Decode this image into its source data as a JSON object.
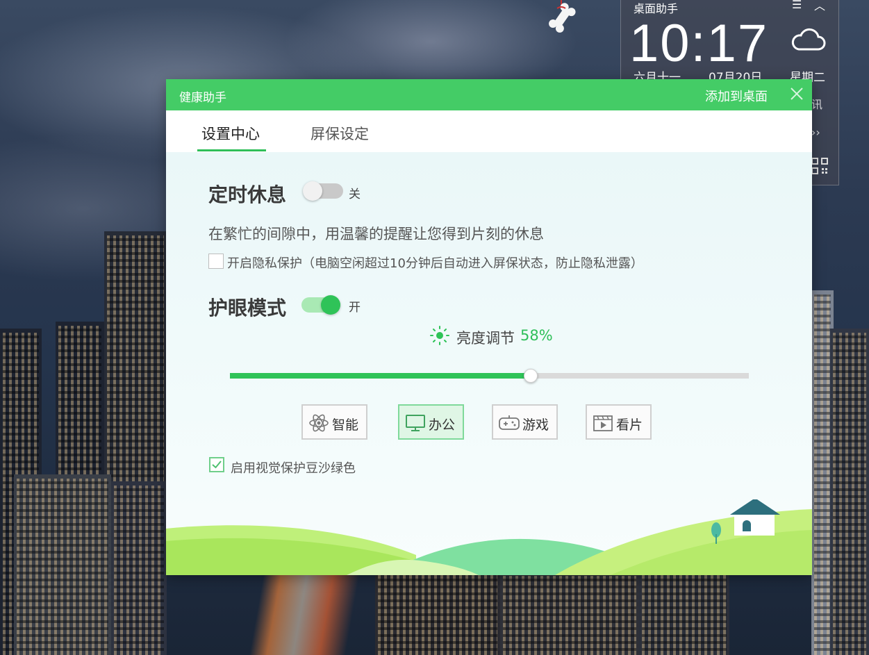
{
  "desktop_widget": {
    "title": "桌面助手",
    "menu_icon": "menu-icon",
    "collapse_icon": "chevron-up-icon",
    "time": "10:17",
    "weather_icon": "cloud-icon",
    "lunar_date": "六月十一",
    "date": "07月20日",
    "weekday": "星期二",
    "side_char_1": "讯",
    "side_icon_2": "chevron-right-icon",
    "side_icon_3": "qr-code-icon"
  },
  "dialog": {
    "title": "健康助手",
    "add_to_desktop": "添加到桌面",
    "close_icon": "close-icon",
    "tabs": [
      {
        "label": "设置中心",
        "active": true
      },
      {
        "label": "屏保设定",
        "active": false
      }
    ]
  },
  "timed_rest": {
    "title": "定时休息",
    "enabled": false,
    "state_label": "关",
    "description": "在繁忙的间隙中，用温馨的提醒让您得到片刻的休息",
    "privacy_checked": false,
    "privacy_label": "开启隐私保护（电脑空闲超过10分钟后自动进入屏保状态，防止隐私泄露）"
  },
  "eye_care": {
    "title": "护眼模式",
    "enabled": true,
    "state_label": "开",
    "brightness_label": "亮度调节",
    "brightness_value": "58%",
    "brightness_fraction": 0.58,
    "modes": [
      {
        "label": "智能",
        "icon": "atom-icon",
        "active": false
      },
      {
        "label": "办公",
        "icon": "monitor-icon",
        "active": true
      },
      {
        "label": "游戏",
        "icon": "gamepad-icon",
        "active": false
      },
      {
        "label": "看片",
        "icon": "film-icon",
        "active": false
      }
    ],
    "green_bg_checked": true,
    "green_bg_label": "启用视觉保护豆沙绿色"
  },
  "colors": {
    "accent": "#44cc66",
    "accent_dark": "#2fc358"
  }
}
